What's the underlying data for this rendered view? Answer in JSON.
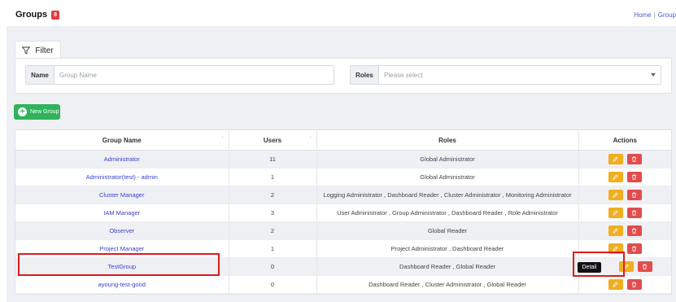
{
  "header": {
    "title": "Groups",
    "count": "8",
    "breadcrumb": [
      "Home",
      "Group"
    ]
  },
  "filter": {
    "tab_label": "Filter",
    "name_label": "Name",
    "name_placeholder": "Group Name",
    "roles_label": "Roles",
    "roles_placeholder": "Please select"
  },
  "toolbar": {
    "new_group_label": "New Group"
  },
  "table": {
    "columns": [
      "Group Name",
      "Users",
      "Roles",
      "Actions"
    ],
    "rows": [
      {
        "name": "Administrator",
        "users": "11",
        "roles": "Global Administrator"
      },
      {
        "name": "Administrator(test) - admin",
        "users": "1",
        "roles": "Global Administrator"
      },
      {
        "name": "Cluster Manager",
        "users": "2",
        "roles": "Logging Administrator , Dashboard Reader , Cluster Administrator , Monitoring Administrator"
      },
      {
        "name": "IAM Manager",
        "users": "3",
        "roles": "User Administrator , Group Administrator , Dashboard Reader , Role Administrator"
      },
      {
        "name": "Observer",
        "users": "2",
        "roles": "Global Reader"
      },
      {
        "name": "Project Manager",
        "users": "1",
        "roles": "Project Administrator , Dashboard Reader"
      },
      {
        "name": "TestGroup",
        "users": "0",
        "roles": "Dashboard Reader , Global Reader"
      },
      {
        "name": "ayoung-test-good",
        "users": "0",
        "roles": "Dashboard Reader , Cluster Administrator , Global Reader"
      }
    ],
    "tooltip": "Detail"
  },
  "colors": {
    "accent": "#2fb35b",
    "edit": "#f1ae1e",
    "delete": "#e24c4c",
    "link": "#3b45c9",
    "highlight": "#e01b1b"
  }
}
